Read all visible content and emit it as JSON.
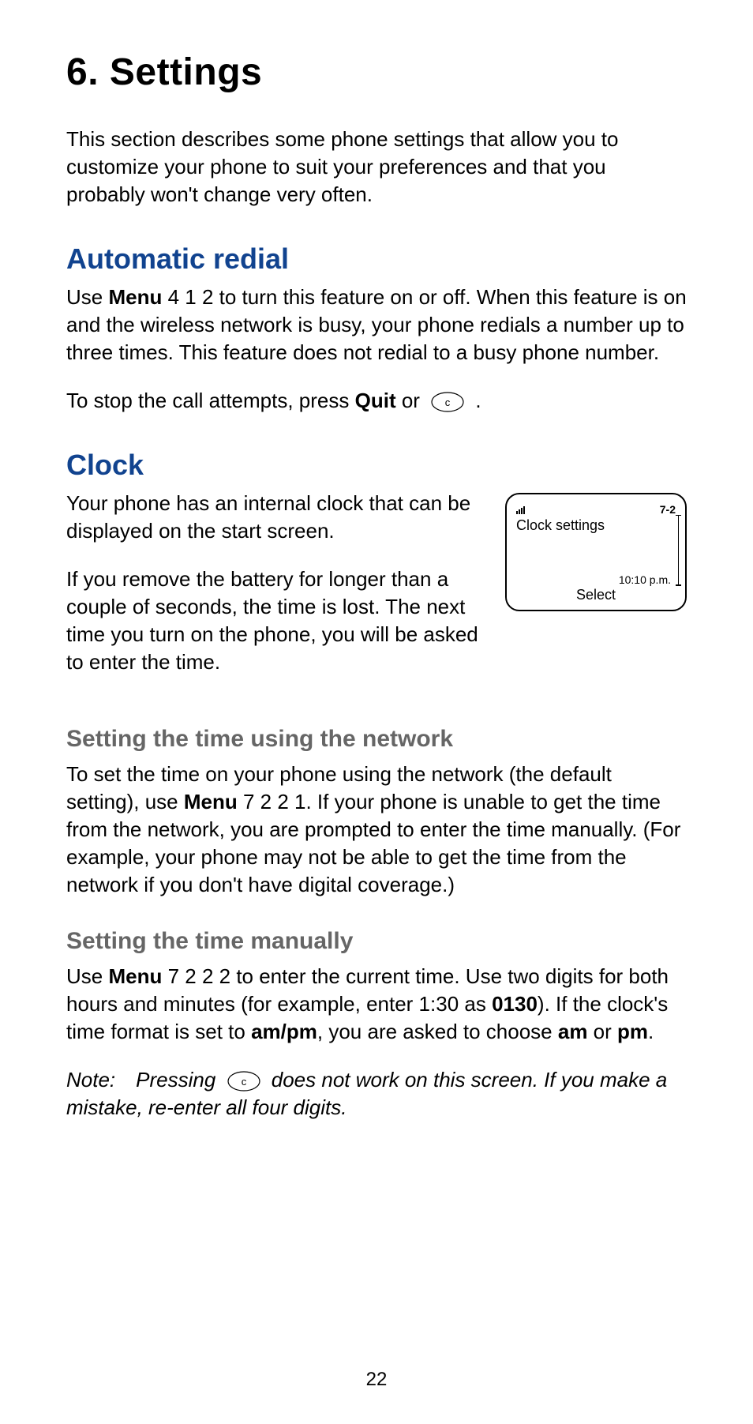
{
  "page_number": "22",
  "chapter": {
    "number": "6.",
    "title": "Settings"
  },
  "intro": "This section describes some phone settings that allow you to customize your phone to suit your preferences and that you probably won't change very often.",
  "auto_redial": {
    "heading": "Automatic redial",
    "p1_pre": "Use ",
    "p1_menu_word": "Menu",
    "p1_post": " 4 1 2 to turn this feature on or off. When this feature is on and the wireless network is busy, your phone redials a number up to three times. This feature does not redial to a busy phone number.",
    "p2_pre": "To stop the call attempts, press ",
    "p2_quit": "Quit",
    "p2_mid": " or ",
    "p2_end": " ."
  },
  "clock": {
    "heading": "Clock",
    "p1": "Your phone has an internal clock that can be displayed on the start screen.",
    "p2": "If you remove the battery for longer than a couple of seconds, the time is lost. The next time you turn on the phone, you will be asked to enter the time.",
    "phone": {
      "menu_number": "7-2",
      "title": "Clock settings",
      "time": "10:10 p.m.",
      "softkey": "Select"
    },
    "net": {
      "heading": "Setting the time using the network",
      "p_pre": "To set the time on your phone using the network (the default setting), use ",
      "menu_word": "Menu",
      "p_post": " 7 2 2 1. If your phone is unable to get the time from the network, you are prompted to enter the time manually. (For example, your phone may not be able to get the time from the network if you don't have digital coverage.)"
    },
    "manual": {
      "heading": "Setting the time manually",
      "p1_a": "Use ",
      "menu_word": "Menu",
      "p1_b": " 7 2 2 2 to enter the current time. Use two digits for both hours and minutes (for example, enter 1:30 as ",
      "p1_0130": "0130",
      "p1_c": "). If the clock's time format is set to ",
      "p1_ampm": "am/pm",
      "p1_d": ", you are asked to choose ",
      "p1_am": "am",
      "p1_e": " or ",
      "p1_pm": "pm",
      "p1_f": ".",
      "note_a": "Note: Pressing ",
      "note_b": " does not work on this screen. If you make a mistake, re-enter all four digits."
    }
  }
}
